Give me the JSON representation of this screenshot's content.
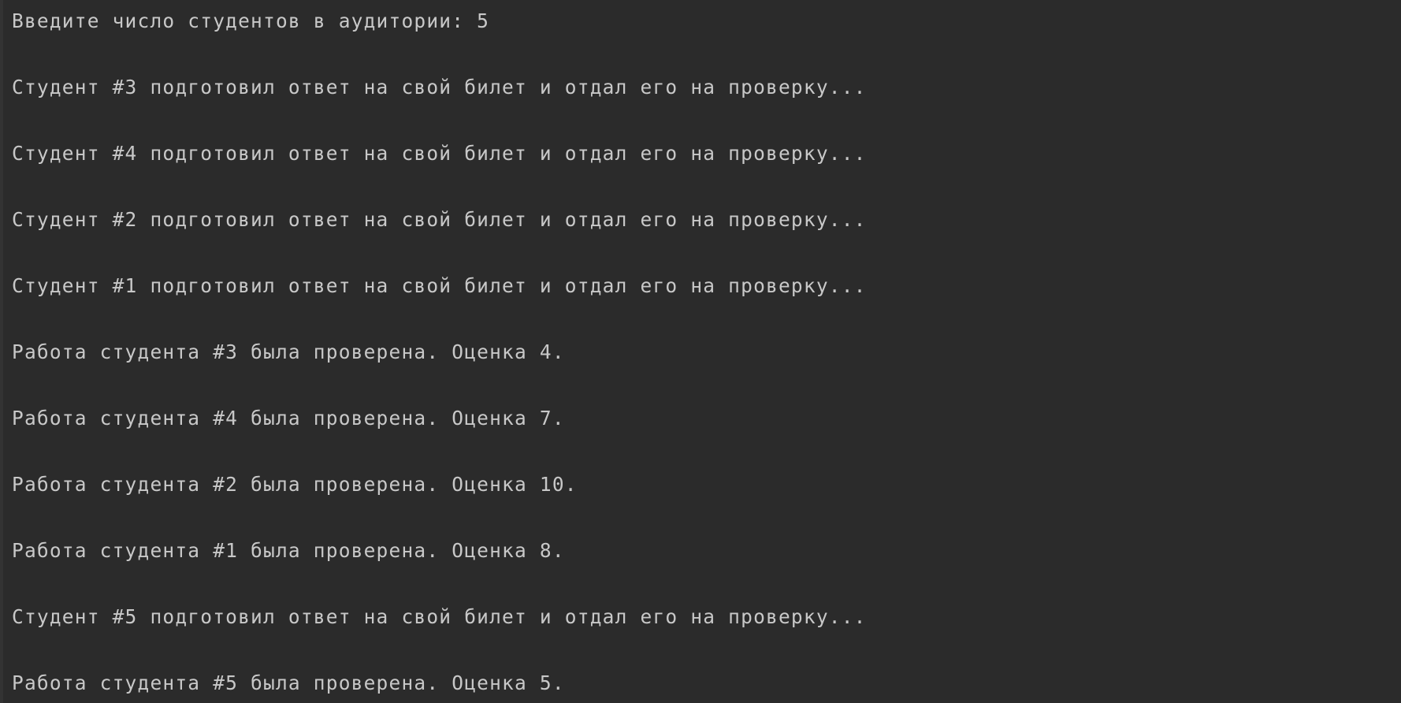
{
  "console": {
    "prompt": {
      "label": "Введите число студентов в аудитории: ",
      "input_value": "5"
    },
    "lines": [
      "Студент #3 подготовил ответ на свой билет и отдал его на проверку...",
      "Студент #4 подготовил ответ на свой билет и отдал его на проверку...",
      "Студент #2 подготовил ответ на свой билет и отдал его на проверку...",
      "Студент #1 подготовил ответ на свой билет и отдал его на проверку...",
      "Работа студента #3 была проверена. Оценка 4.",
      "Работа студента #4 была проверена. Оценка 7.",
      "Работа студента #2 была проверена. Оценка 10.",
      "Работа студента #1 была проверена. Оценка 8.",
      "Студент #5 подготовил ответ на свой билет и отдал его на проверку...",
      "Работа студента #5 была проверена. Оценка 5."
    ]
  }
}
